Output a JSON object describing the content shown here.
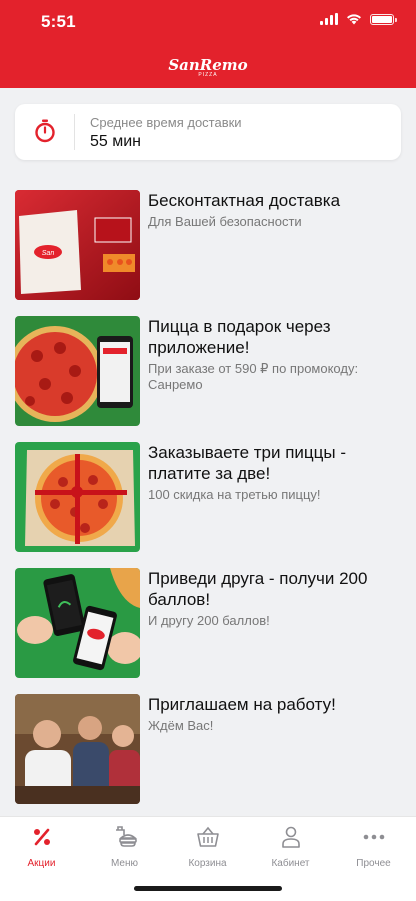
{
  "status_bar": {
    "time": "5:51"
  },
  "header": {
    "logo_text": "SanRemo",
    "logo_sub": "PIZZA"
  },
  "delivery": {
    "label": "Среднее время доставки",
    "value": "55 мин",
    "icon": "stopwatch-icon"
  },
  "promos": [
    {
      "title": "Бесконтактная доставка",
      "subtitle": "Для Вашей безопасности"
    },
    {
      "title": "Пицца в подарок через приложение!",
      "subtitle": "При заказе от 590 ₽ по промокоду: Санремо"
    },
    {
      "title": "Заказываете три пиццы - платите за две!",
      "subtitle": "100 скидка на третью пиццу!"
    },
    {
      "title": "Приведи друга - получи 200 баллов!",
      "subtitle": "И другу 200 баллов!"
    },
    {
      "title": "Приглашаем на работу!",
      "subtitle": "Ждём Вас!"
    }
  ],
  "tabbar": {
    "items": [
      {
        "label": "Акции",
        "icon": "percent-icon",
        "active": true
      },
      {
        "label": "Меню",
        "icon": "food-menu-icon",
        "active": false
      },
      {
        "label": "Корзина",
        "icon": "basket-icon",
        "active": false
      },
      {
        "label": "Кабинет",
        "icon": "user-icon",
        "active": false
      },
      {
        "label": "Прочее",
        "icon": "more-dots-icon",
        "active": false
      }
    ]
  },
  "colors": {
    "brand": "#e3222c",
    "background": "#f0f1f3",
    "text": "#111111",
    "muted": "#777777"
  }
}
